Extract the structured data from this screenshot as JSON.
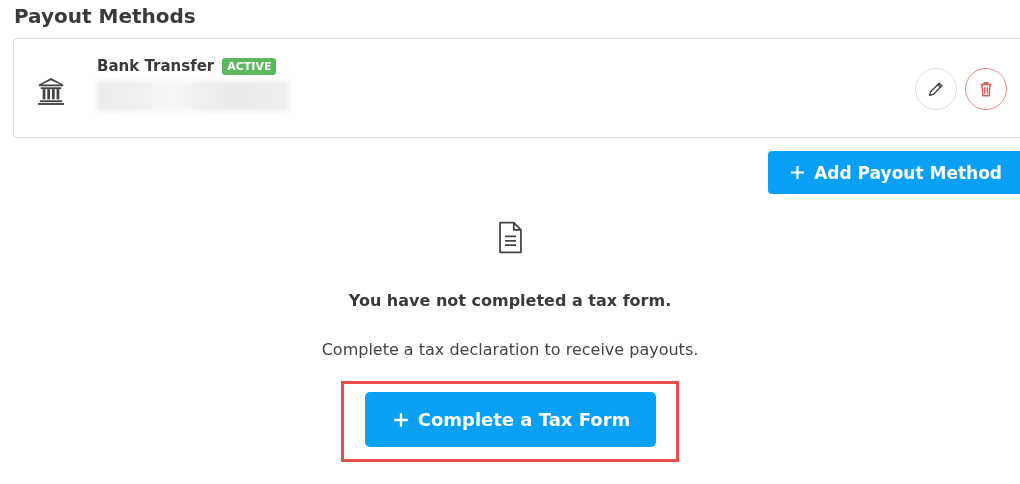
{
  "section_title": "Payout Methods",
  "payout_methods": [
    {
      "name": "Bank Transfer",
      "kind": "bank",
      "status": {
        "label": "ACTIVE",
        "kind": "active"
      },
      "details_redacted": true
    }
  ],
  "add_button": {
    "label": "Add Payout Method"
  },
  "tax_notice": {
    "heading": "You have not completed a tax form.",
    "message": "Complete a tax declaration to receive payouts.",
    "button": {
      "label": "Complete a Tax Form",
      "highlighted": true
    }
  }
}
